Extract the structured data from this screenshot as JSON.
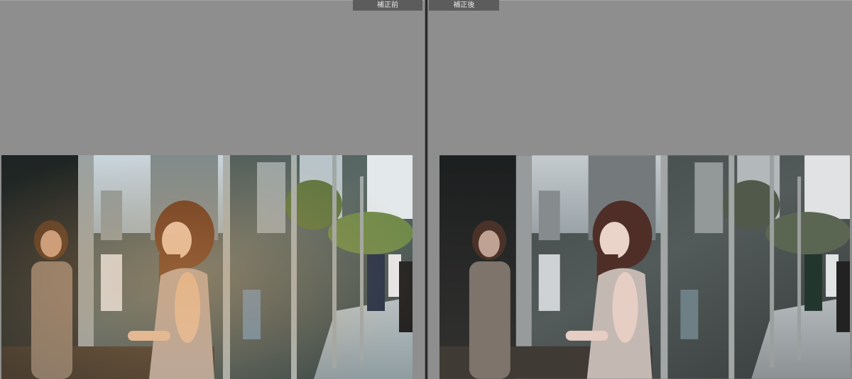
{
  "viewer": {
    "before_label": "補正前",
    "after_label": "補正後"
  },
  "colors": {
    "workspace_bg": "#8e8e8e",
    "label_bg": "#5c5c5c",
    "label_text": "#e6e6e6",
    "divider": "#2a2a2a"
  },
  "photos": {
    "before": {
      "description_icon": "portrait-photo-icon",
      "grade": "warm"
    },
    "after": {
      "description_icon": "portrait-photo-icon",
      "grade": "cool-desaturated"
    }
  }
}
